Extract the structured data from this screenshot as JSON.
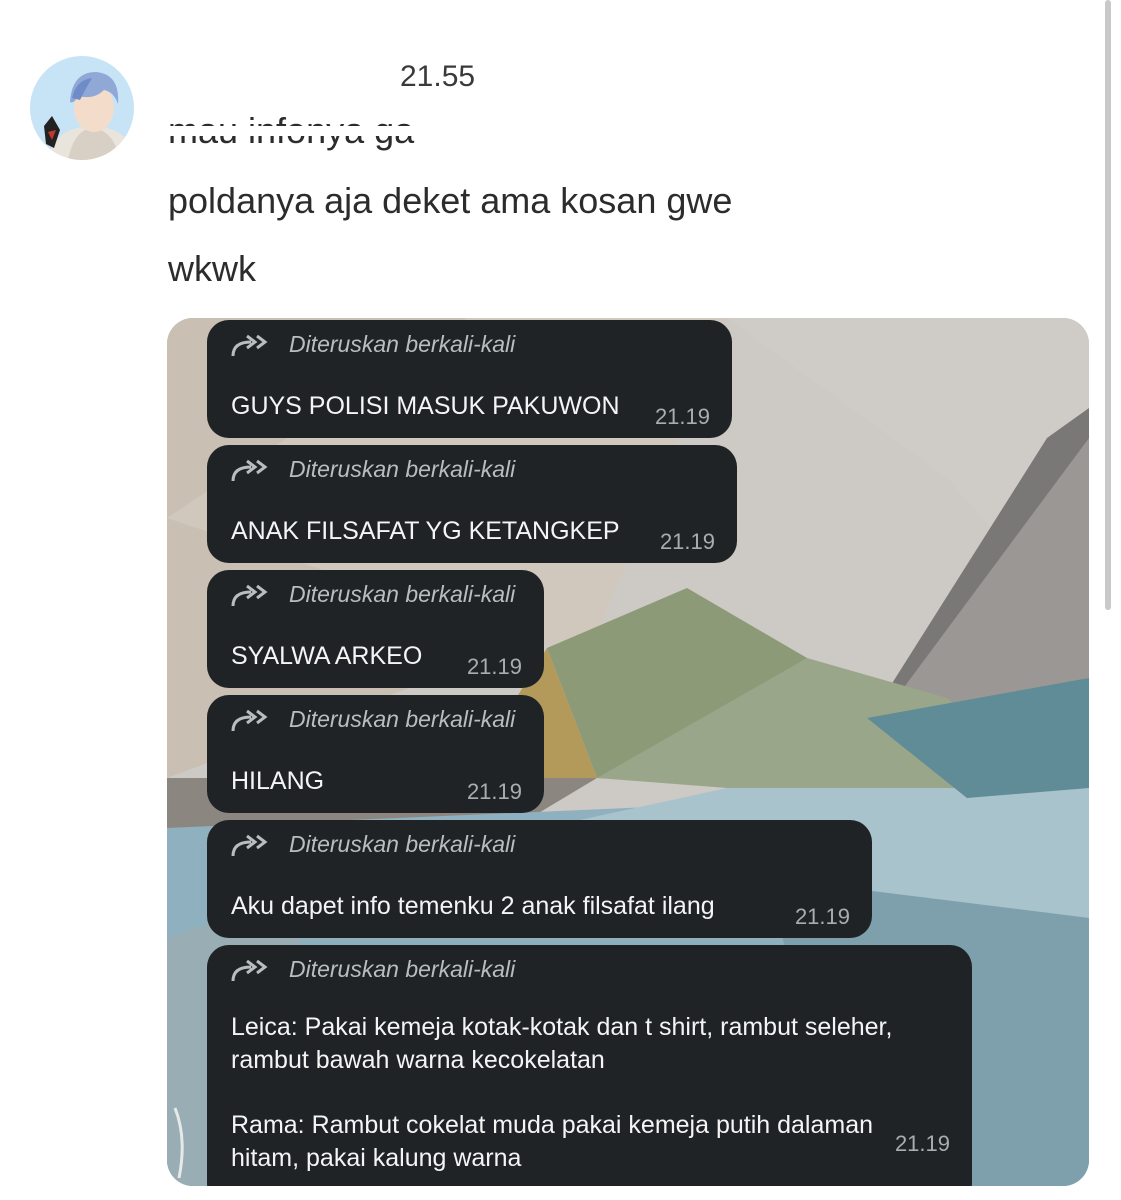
{
  "post": {
    "timestamp": "21.55",
    "lines": [
      "mau infonya ga",
      "poldanya aja deket ama kosan gwe",
      "wkwk"
    ]
  },
  "forward_label": "Diteruskan berkali-kali",
  "bubbles": [
    {
      "text": "GUYS POLISI MASUK PAKUWON",
      "time": "21.19"
    },
    {
      "text": "ANAK FILSAFAT YG KETANGKEP",
      "time": "21.19"
    },
    {
      "text": "SYALWA ARKEO",
      "time": "21.19"
    },
    {
      "text": "HILANG",
      "time": "21.19"
    },
    {
      "text": "Aku dapet info temenku 2 anak filsafat ilang",
      "time": "21.19"
    },
    {
      "para1_line1": "Leica: Pakai kemeja kotak-kotak dan t shirt, rambut seleher,",
      "para1_line2": "rambut bawah warna kecokelatan",
      "para2_line1": "Rama: Rambut cokelat muda pakai kemeja putih dalaman",
      "para2_line2": "hitam, pakai kalung warna",
      "time": "21.19"
    }
  ],
  "icons": {
    "avatar": "anime-avatar",
    "forward": "double-forward-arrow-icon"
  }
}
